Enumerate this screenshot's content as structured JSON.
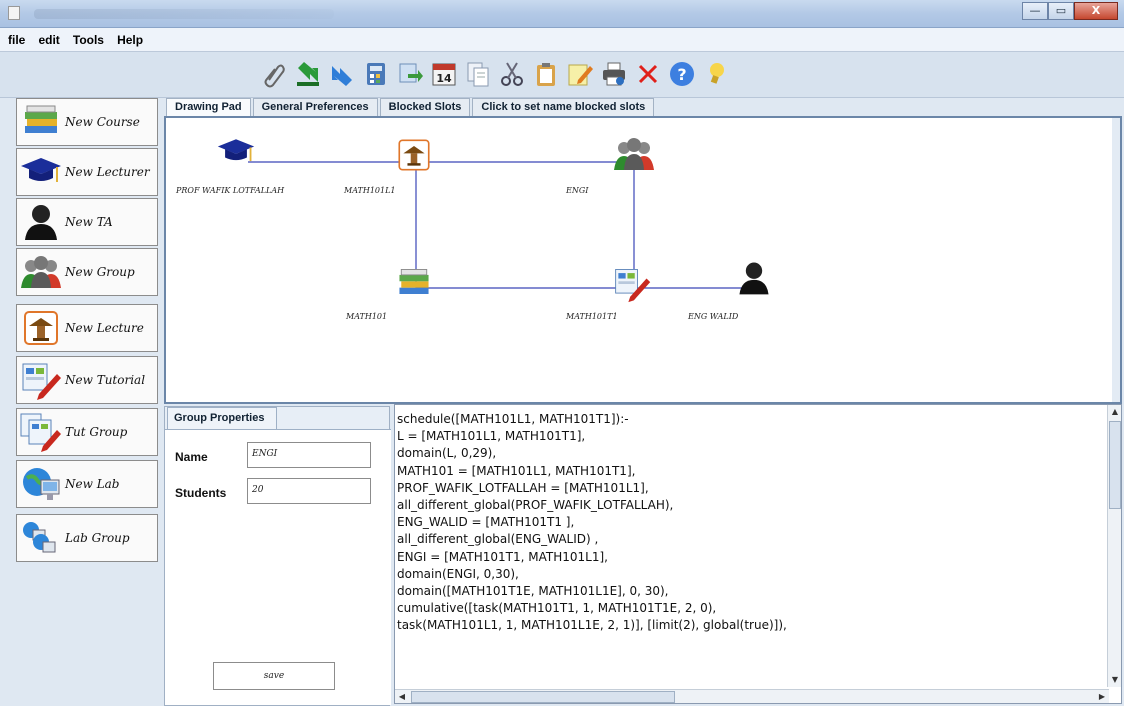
{
  "window": {
    "controls": {
      "minimize": "—",
      "maximize": "▭",
      "close": "X"
    }
  },
  "menu": {
    "items": [
      {
        "label": "file"
      },
      {
        "label": "edit"
      },
      {
        "label": "Tools"
      },
      {
        "label": "Help"
      }
    ]
  },
  "toolbar": {
    "icons": [
      "paperclip-icon",
      "import-arrow-icon",
      "export-arrow-icon",
      "calculator-icon",
      "send-document-icon",
      "calendar-icon",
      "copy-document-icon",
      "scissors-icon",
      "clipboard-icon",
      "edit-note-icon",
      "print-icon",
      "delete-icon",
      "help-icon",
      "lightbulb-icon"
    ],
    "calendar_day": "14"
  },
  "left_panel": {
    "buttons": [
      {
        "label": "New Course",
        "icon": "books-icon"
      },
      {
        "label": "New Lecturer",
        "icon": "graduation-cap-icon"
      },
      {
        "label": "New TA",
        "icon": "person-silhouette-icon"
      },
      {
        "label": "New Group",
        "icon": "group-icon"
      },
      {
        "label": "New Lecture",
        "icon": "lectern-icon"
      },
      {
        "label": "New Tutorial",
        "icon": "tutorial-icon"
      },
      {
        "label": "Tut Group",
        "icon": "tutorial-group-icon"
      },
      {
        "label": "New Lab",
        "icon": "computer-globe-icon"
      },
      {
        "label": "Lab Group",
        "icon": "lab-group-icon"
      }
    ]
  },
  "tabs": [
    {
      "label": "Drawing Pad",
      "active": true
    },
    {
      "label": "General Preferences",
      "active": false
    },
    {
      "label": "Blocked Slots",
      "active": false
    },
    {
      "label": "Click to set name blocked slots",
      "active": false
    }
  ],
  "drawing_pad": {
    "nodes": [
      {
        "label": "PROF WAFIK LOTFALLAH",
        "icon": "graduation-cap-icon"
      },
      {
        "label": "MATH101L1",
        "icon": "lectern-icon"
      },
      {
        "label": "ENGI",
        "icon": "group-icon"
      },
      {
        "label": "MATH101",
        "icon": "books-icon"
      },
      {
        "label": "MATH101T1",
        "icon": "tutorial-icon"
      },
      {
        "label": "ENG WALID",
        "icon": "person-silhouette-icon"
      }
    ]
  },
  "group_properties": {
    "tab_label": "Group Properties",
    "name_label": "Name",
    "name_value": "ENGI",
    "students_label": "Students",
    "students_value": "20",
    "save_label": "save"
  },
  "code": {
    "lines": [
      "schedule([MATH101L1, MATH101T1]):-",
      " L = [MATH101L1, MATH101T1],",
      "domain(L, 0,29),",
      "MATH101 = [MATH101L1, MATH101T1],",
      "PROF_WAFIK_LOTFALLAH = [MATH101L1],",
      "all_different_global(PROF_WAFIK_LOTFALLAH),",
      "ENG_WALID = [MATH101T1 ],",
      " all_different_global(ENG_WALID) ,",
      "ENGI = [MATH101T1, MATH101L1],",
      "domain(ENGI, 0,30),",
      "domain([MATH101T1E, MATH101L1E], 0, 30),",
      "cumulative([task(MATH101T1, 1, MATH101T1E, 2, 0),",
      "task(MATH101L1, 1, MATH101L1E, 2, 1)], [limit(2), global(true)]),"
    ]
  }
}
